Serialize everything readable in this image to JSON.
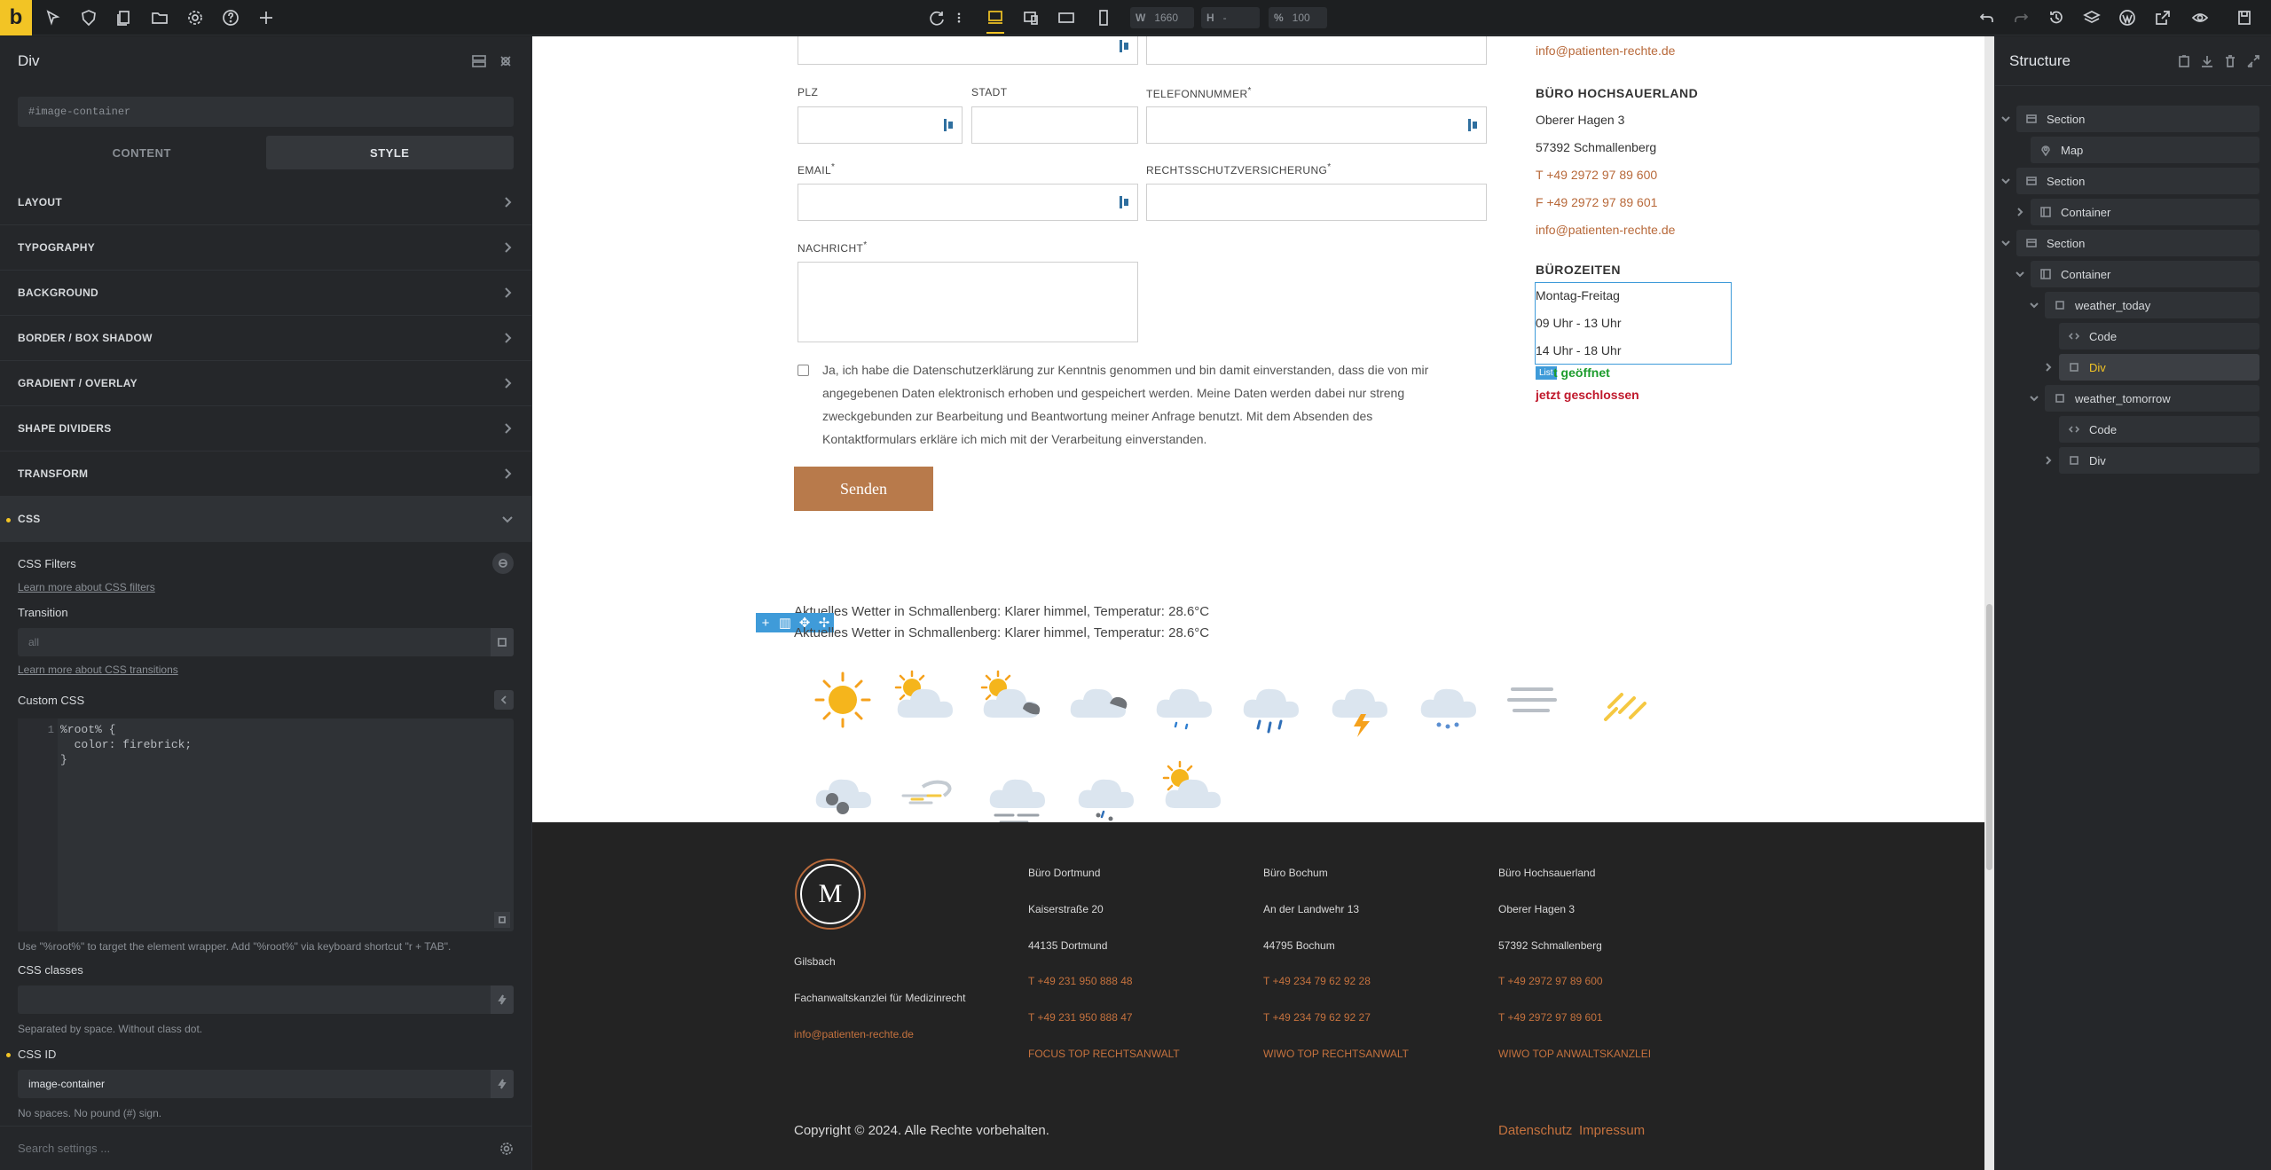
{
  "toolbar": {
    "logo": "b",
    "width_label": "W",
    "width_value": "1660",
    "height_label": "H",
    "height_value": "-",
    "zoom_label": "%",
    "zoom_value": "100"
  },
  "left_panel": {
    "title": "Div",
    "element_id": "#image-container",
    "tabs": {
      "content": "CONTENT",
      "style": "STYLE"
    },
    "sections": [
      "LAYOUT",
      "TYPOGRAPHY",
      "BACKGROUND",
      "BORDER / BOX SHADOW",
      "GRADIENT / OVERLAY",
      "SHAPE DIVIDERS",
      "TRANSFORM"
    ],
    "css_section": "CSS",
    "css_filters_label": "CSS Filters",
    "css_filters_link": "Learn more about CSS filters",
    "transition_label": "Transition",
    "transition_placeholder": "all",
    "transition_link": "Learn more about CSS transitions",
    "custom_css_label": "Custom CSS",
    "custom_css_line": "1",
    "custom_css_code": "%root% {\n  color: firebrick;\n}",
    "custom_css_hint": "Use \"%root%\" to target the element wrapper. Add \"%root%\" via keyboard shortcut \"r + TAB\".",
    "css_classes_label": "CSS classes",
    "css_classes_hint": "Separated by space. Without class dot.",
    "css_id_label": "CSS ID",
    "css_id_value": "image-container",
    "css_id_hint": "No spaces. No pound (#) sign.",
    "search_placeholder": "Search settings ..."
  },
  "form": {
    "plz": "PLZ",
    "stadt": "STADT",
    "telefon": "TELEFONNUMMER",
    "email": "EMAIL",
    "rechtsschutz": "RECHTSSCHUTZVERSICHERUNG",
    "nachricht": "NACHRICHT",
    "required_mark": "*",
    "consent": "Ja, ich habe die Datenschutzerklärung zur Kenntnis genommen und bin damit einverstanden, dass die von mir angegebenen Daten elektronisch erhoben und gespeichert werden. Meine Daten werden dabei nur streng zweckgebunden zur Bearbeitung und Beantwortung meiner Anfrage benutzt. Mit dem Absenden des Kontaktformulars erkläre ich mich mit der Verarbeitung einverstanden.",
    "send": "Senden"
  },
  "contact": {
    "email_top": "info@patienten-rechte.de",
    "office_heading": "BÜRO HOCHSAUERLAND",
    "street": "Oberer Hagen 3",
    "city": "57392 Schmallenberg",
    "phone": "T +49 2972 97 89 600",
    "fax": "F +49 2972 97 89 601",
    "email": "info@patienten-rechte.de",
    "hours_heading": "BÜROZEITEN",
    "days": "Montag-Freitag",
    "hours1": "09 Uhr - 13 Uhr",
    "hours2": "14 Uhr - 18 Uhr",
    "list_tag": "List",
    "open_status": "t geöffnet",
    "closed_status": "jetzt geschlossen"
  },
  "weather": {
    "line1": "Aktuelles Wetter in Schmallenberg: Klarer himmel, Temperatur: 28.6°C",
    "line2": "Aktuelles Wetter in Schmallenberg: Klarer himmel, Temperatur: 28.6°C",
    "icons": [
      "clear-sun",
      "sun-cloud",
      "sun-dark-cloud",
      "clouds",
      "cloud-drizzle",
      "cloud-rain",
      "cloud-thunder",
      "cloud-snow",
      "fog",
      "sleet",
      "hail",
      "wind",
      "cloud-mist",
      "cloud-snow-rain",
      "sun-cloud-small"
    ]
  },
  "footer": {
    "logo_text": "M",
    "company": "Gilsbach",
    "tagline": "Fachanwaltskanzlei für Medizinrecht",
    "email": "info@patienten-rechte.de",
    "offices": [
      {
        "name": "Büro Dortmund",
        "street": "Kaiserstraße 20",
        "city": "44135 Dortmund",
        "phone": "T +49 231 950 888 48",
        "fax": "T +49 231 950 888 47",
        "badge": "FOCUS TOP RECHTSANWALT"
      },
      {
        "name": "Büro Bochum",
        "street": "An der Landwehr 13",
        "city": "44795 Bochum",
        "phone": "T +49 234 79 62 92 28",
        "fax": "T +49 234 79 62 92 27",
        "badge": "WIWO TOP RECHTSANWALT"
      },
      {
        "name": "Büro Hochsauerland",
        "street": "Oberer Hagen 3",
        "city": "57392 Schmallenberg",
        "phone": "T +49 2972 97 89 600",
        "fax": "T +49 2972 97 89 601",
        "badge": "WIWO TOP ANWALTSKANZLEI"
      }
    ],
    "copyright": "Copyright © 2024. Alle Rechte vorbehalten.",
    "datenschutz": "Datenschutz",
    "impressum": "Impressum"
  },
  "structure": {
    "title": "Structure",
    "nodes": [
      "Section",
      "Map",
      "Section",
      "Container",
      "Section",
      "Container",
      "weather_today",
      "Code",
      "Div",
      "weather_tomorrow",
      "Code",
      "Div"
    ]
  }
}
